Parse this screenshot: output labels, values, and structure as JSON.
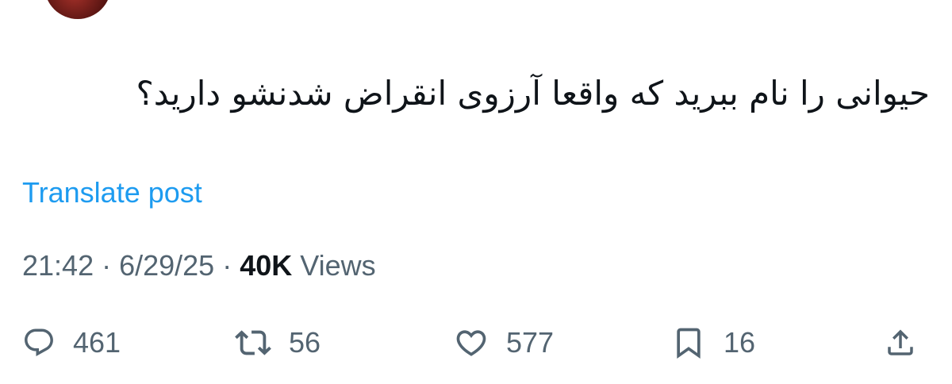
{
  "post": {
    "text": "حیوانی را نام ببرید که واقعا آرزوی انقراض شدنشو دارید؟",
    "translate_label": "Translate post",
    "time": "21:42",
    "separator": " · ",
    "date": "6/29/25",
    "views_count": "40K",
    "views_label": " Views"
  },
  "actions": {
    "replies": "461",
    "reposts": "56",
    "likes": "577",
    "bookmarks": "16"
  },
  "colors": {
    "text": "#0f1419",
    "secondary": "#536471",
    "accent": "#1d9bf0"
  },
  "icons": [
    "reply-icon",
    "repost-icon",
    "like-icon",
    "bookmark-icon",
    "share-icon"
  ]
}
